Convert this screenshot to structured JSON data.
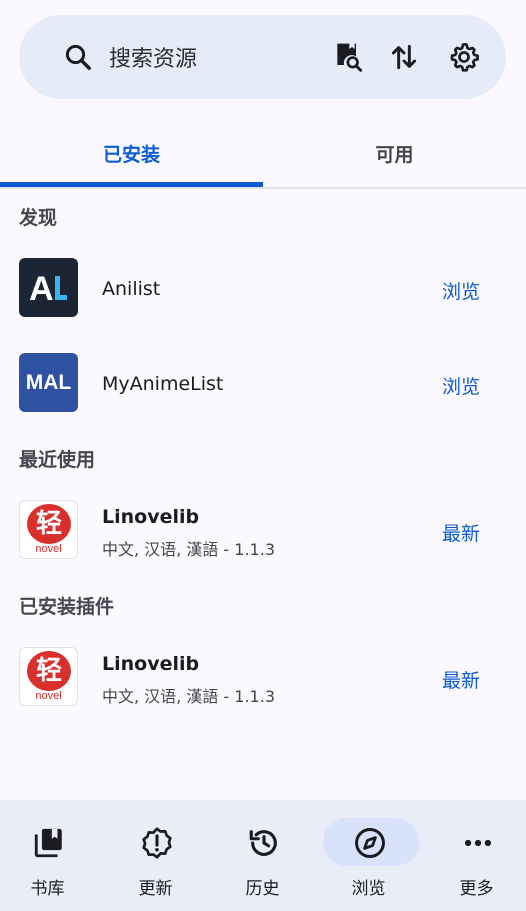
{
  "search": {
    "placeholder": "搜索资源",
    "icons": [
      "search-icon",
      "book-search-icon",
      "sort-icon",
      "gear-icon"
    ]
  },
  "tabs": [
    {
      "label": "已安装",
      "active": true
    },
    {
      "label": "可用",
      "active": false
    }
  ],
  "sections": {
    "discover": {
      "title": "发现",
      "items": [
        {
          "name": "Anilist",
          "action": "浏览",
          "logo_text": "AL"
        },
        {
          "name": "MyAnimeList",
          "action": "浏览",
          "logo_text": "MAL"
        }
      ]
    },
    "recent": {
      "title": "最近使用",
      "items": [
        {
          "name": "Linovelib",
          "meta": "中文, 汉语, 漢語 - 1.1.3",
          "action": "最新",
          "logo_text": "轻",
          "logo_sub": "novel"
        }
      ]
    },
    "installed_plugins": {
      "title": "已安装插件",
      "items": [
        {
          "name": "Linovelib",
          "meta": "中文, 汉语, 漢語 - 1.1.3",
          "action": "最新",
          "logo_text": "轻",
          "logo_sub": "novel"
        }
      ]
    }
  },
  "bottom_nav": [
    {
      "label": "书库",
      "icon": "library-icon",
      "active": false
    },
    {
      "label": "更新",
      "icon": "updates-icon",
      "active": false
    },
    {
      "label": "历史",
      "icon": "history-icon",
      "active": false
    },
    {
      "label": "浏览",
      "icon": "compass-icon",
      "active": true
    },
    {
      "label": "更多",
      "icon": "more-icon",
      "active": false
    }
  ],
  "colors": {
    "accent": "#0a5bd4",
    "background": "#fcf8ff",
    "search_bar": "#e6ebf8",
    "nav_bar": "#e8edf8",
    "anilist_bg": "#1c2533",
    "mal_bg": "#2e51a2",
    "linovelib_red": "#d9302e"
  }
}
